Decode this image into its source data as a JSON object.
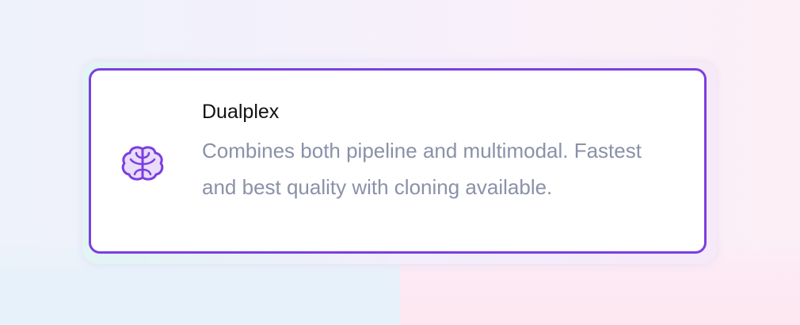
{
  "option": {
    "title": "Dualplex",
    "description": "Combines both pipeline and multimodal. Fastest and best quality with cloning available.",
    "icon": "brain-icon",
    "selected": true
  },
  "colors": {
    "accent": "#7b3fe0",
    "icon_fill": "#e9ddfb",
    "title": "#111111",
    "description": "#8a91a8",
    "card_background": "#ffffff"
  }
}
